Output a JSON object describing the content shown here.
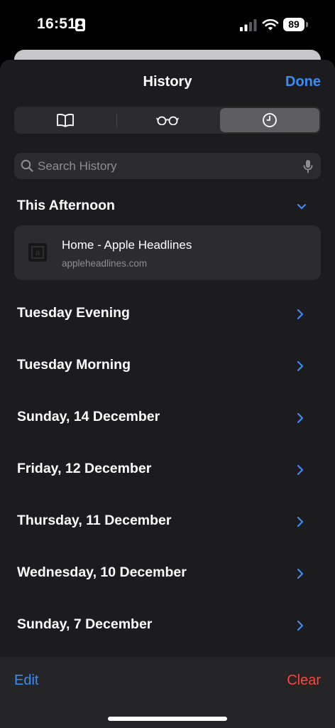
{
  "status_bar": {
    "time": "16:51",
    "battery": "89"
  },
  "header": {
    "title": "History",
    "done_label": "Done"
  },
  "segments": [
    {
      "name": "bookmarks",
      "icon": "book-icon"
    },
    {
      "name": "reading-list",
      "icon": "glasses-icon"
    },
    {
      "name": "history",
      "icon": "clock-icon",
      "selected": true
    }
  ],
  "search": {
    "placeholder": "Search History",
    "value": ""
  },
  "sections": [
    {
      "label": "This Afternoon",
      "expanded": true
    },
    {
      "label": "Tuesday Evening",
      "expanded": false
    },
    {
      "label": "Tuesday Morning",
      "expanded": false
    },
    {
      "label": "Sunday, 14 December",
      "expanded": false
    },
    {
      "label": "Friday, 12 December",
      "expanded": false
    },
    {
      "label": "Thursday, 11 December",
      "expanded": false
    },
    {
      "label": "Wednesday, 10 December",
      "expanded": false
    },
    {
      "label": "Sunday, 7 December",
      "expanded": false
    }
  ],
  "afternoon_items": [
    {
      "title": "Home - Apple Headlines",
      "url": "appleheadlines.com",
      "favicon_letter": "a"
    }
  ],
  "toolbar": {
    "edit_label": "Edit",
    "clear_label": "Clear"
  },
  "colors": {
    "accent": "#3b8cf5",
    "destructive": "#ff453a",
    "background": "#1c1c1e",
    "card": "#2c2c2e"
  }
}
